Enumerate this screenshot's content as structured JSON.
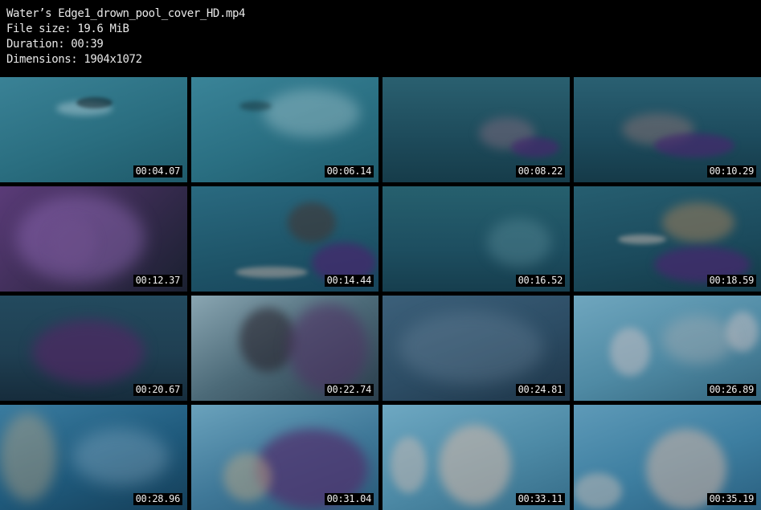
{
  "header": {
    "filename": "Water’s Edge1_drown_pool_cover_HD.mp4",
    "file_size": "File size: 19.6 MiB",
    "duration": "Duration: 00:39",
    "dimensions": "Dimensions: 1904x1072"
  },
  "thumbnails": [
    {
      "timestamp": "00:04.07",
      "bg": "#2a6e80"
    },
    {
      "timestamp": "00:06.14",
      "bg": "#2a6f82"
    },
    {
      "timestamp": "00:08.22",
      "bg": "#1d4a5a"
    },
    {
      "timestamp": "00:10.29",
      "bg": "#1c4a5c"
    },
    {
      "timestamp": "00:12.37",
      "bg": "#3a2c52"
    },
    {
      "timestamp": "00:14.44",
      "bg": "#1e5468"
    },
    {
      "timestamp": "00:16.52",
      "bg": "#1d4e60"
    },
    {
      "timestamp": "00:18.59",
      "bg": "#1b4a5c"
    },
    {
      "timestamp": "00:20.67",
      "bg": "#1f3f52"
    },
    {
      "timestamp": "00:22.74",
      "bg": "#4c6a78"
    },
    {
      "timestamp": "00:24.81",
      "bg": "#2c4c64"
    },
    {
      "timestamp": "00:26.89",
      "bg": "#4f8aa4"
    },
    {
      "timestamp": "00:28.96",
      "bg": "#1f5a7c"
    },
    {
      "timestamp": "00:31.04",
      "bg": "#3f7898"
    },
    {
      "timestamp": "00:33.11",
      "bg": "#4d8aa6"
    },
    {
      "timestamp": "00:35.19",
      "bg": "#3d7ea0"
    }
  ]
}
